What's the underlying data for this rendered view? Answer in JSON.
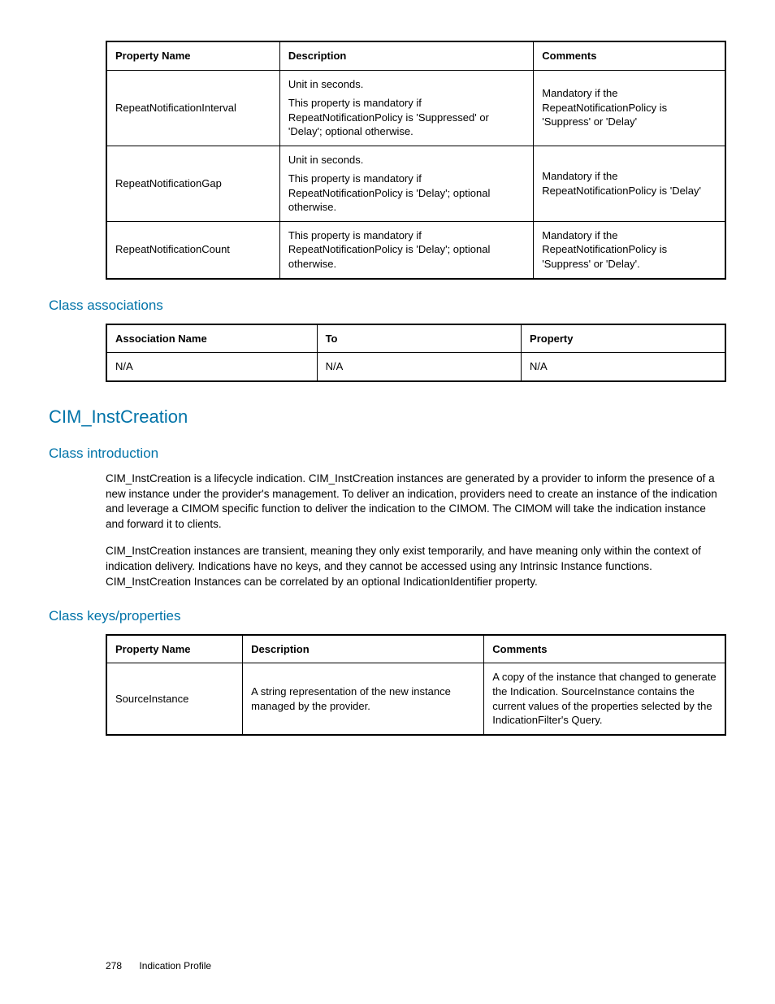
{
  "table1": {
    "headers": [
      "Property Name",
      "Description",
      "Comments"
    ],
    "rows": [
      {
        "name": "RepeatNotificationInterval",
        "desc1": "Unit in seconds.",
        "desc2": "This property is mandatory if RepeatNotificationPolicy is 'Suppressed' or 'Delay'; optional otherwise.",
        "comments": "Mandatory if the RepeatNotificationPolicy is 'Suppress' or 'Delay'"
      },
      {
        "name": "RepeatNotificationGap",
        "desc1": "Unit in seconds.",
        "desc2": "This property is mandatory if RepeatNotificationPolicy is 'Delay'; optional otherwise.",
        "comments": "Mandatory if the RepeatNotificationPolicy is 'Delay'"
      },
      {
        "name": "RepeatNotificationCount",
        "desc1": "This property is mandatory if RepeatNotificationPolicy is 'Delay'; optional otherwise.",
        "desc2": "",
        "comments": "Mandatory if the RepeatNotificationPolicy is 'Suppress' or 'Delay'."
      }
    ]
  },
  "sections": {
    "assoc_heading": "Class associations",
    "cim_heading": "CIM_InstCreation",
    "intro_heading": "Class introduction",
    "keys_heading": "Class keys/properties"
  },
  "table2": {
    "headers": [
      "Association Name",
      "To",
      "Property"
    ],
    "row": {
      "c1": "N/A",
      "c2": "N/A",
      "c3": "N/A"
    }
  },
  "intro": {
    "p1": "CIM_InstCreation is a lifecycle indication. CIM_InstCreation instances are generated by a provider to inform the presence of a new instance under the provider's management. To deliver an indication, providers need to create an instance of the indication and leverage a CIMOM specific function to deliver the indication to the CIMOM. The CIMOM will take the indication instance and forward it to clients.",
    "p2": "CIM_InstCreation instances are transient, meaning they only exist temporarily, and have meaning only within the context of indication delivery. Indications have no keys, and they cannot be accessed using any Intrinsic Instance functions. CIM_InstCreation Instances can be correlated by an optional IndicationIdentifier property."
  },
  "table3": {
    "headers": [
      "Property Name",
      "Description",
      "Comments"
    ],
    "row": {
      "name": "SourceInstance",
      "desc": "A string representation of the new instance managed by the provider.",
      "comments": "A copy of the instance that changed to generate the Indication. SourceInstance contains the current values of the properties selected by the IndicationFilter's Query."
    }
  },
  "footer": {
    "page": "278",
    "title": "Indication Profile"
  }
}
